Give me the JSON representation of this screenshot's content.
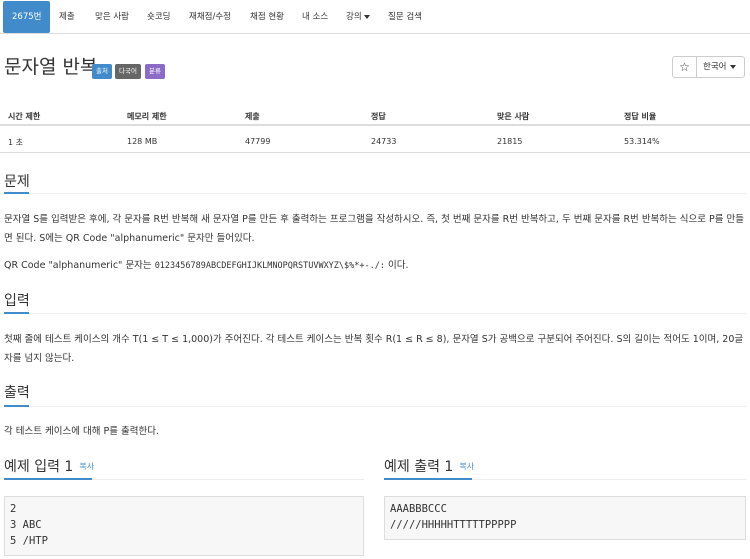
{
  "nav": {
    "items": [
      {
        "label": "2675번"
      },
      {
        "label": "제출"
      },
      {
        "label": "맞은 사람"
      },
      {
        "label": "숏코딩"
      },
      {
        "label": "재채점/수정"
      },
      {
        "label": "채점 현황"
      },
      {
        "label": "내 소스"
      },
      {
        "label": "강의"
      },
      {
        "label": "질문 검색"
      }
    ]
  },
  "problem": {
    "title": "문자열 반복",
    "labels": {
      "source": "출처",
      "multilang": "다국어",
      "category": "분류"
    }
  },
  "controls": {
    "star": "☆",
    "language": "한국어"
  },
  "info": {
    "headers": [
      "시간 제한",
      "메모리 제한",
      "제출",
      "정답",
      "맞은 사람",
      "정답 비율"
    ],
    "values": [
      "1 초",
      "128 MB",
      "47799",
      "24733",
      "21815",
      "53.314%"
    ]
  },
  "sections": {
    "problem": {
      "title": "문제",
      "line1": "문자열 S를 입력받은 후에, 각 문자를 R번 반복해 새 문자열 P를 만든 후 출력하는 프로그램을 작성하시오. 즉, 첫 번째 문자를 R번 반복하고, 두 번째 문자를 R번 반복하는 식으로 P를 만들면 된다. S에는 QR Code \"alphanumeric\" 문자만 들어있다.",
      "line2_prefix": "QR Code \"alphanumeric\" 문자는 ",
      "line2_code": "0123456789ABCDEFGHIJKLMNOPQRSTUVWXYZ\\$%*+-./:",
      "line2_suffix": " 이다."
    },
    "input": {
      "title": "입력",
      "text": "첫째 줄에 테스트 케이스의 개수 T(1 ≤ T ≤ 1,000)가 주어진다. 각 테스트 케이스는 반복 횟수 R(1 ≤ R ≤ 8), 문자열 S가 공백으로 구분되어 주어진다. S의 길이는 적어도 1이며, 20글자를 넘지 않는다."
    },
    "output": {
      "title": "출력",
      "text": "각 테스트 케이스에 대해 P를 출력한다."
    },
    "sample_input": {
      "title": "예제 입력 1",
      "copy": "복사",
      "content": "2\n3 ABC\n5 /HTP"
    },
    "sample_output": {
      "title": "예제 출력 1",
      "copy": "복사",
      "content": "AAABBBCCC\n/////HHHHHTTTTTPPPPP"
    }
  }
}
